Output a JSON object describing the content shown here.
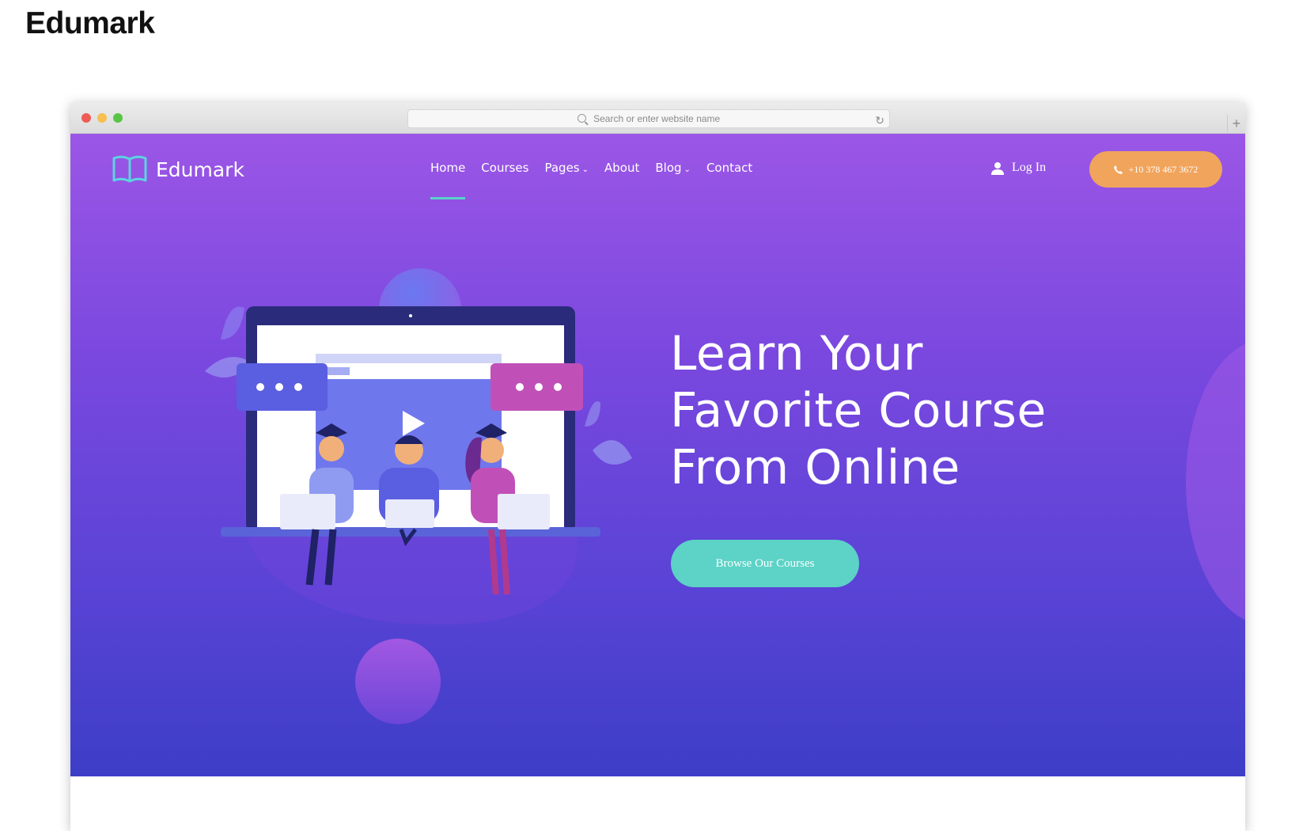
{
  "page": {
    "title": "Edumark"
  },
  "browser": {
    "address_placeholder": "Search or enter website name",
    "newtab_label": "+"
  },
  "site": {
    "logo_text": "Edumark",
    "nav": [
      {
        "label": "Home",
        "active": true,
        "dropdown": false
      },
      {
        "label": "Courses",
        "active": false,
        "dropdown": false
      },
      {
        "label": "Pages",
        "active": false,
        "dropdown": true
      },
      {
        "label": "About",
        "active": false,
        "dropdown": false
      },
      {
        "label": "Blog",
        "active": false,
        "dropdown": true
      },
      {
        "label": "Contact",
        "active": false,
        "dropdown": false
      }
    ],
    "login_label": "Log In",
    "phone": "+10 378 467 3672"
  },
  "hero": {
    "heading_lines": [
      "Learn Your",
      "Favorite Course",
      "From Online"
    ],
    "cta_label": "Browse Our Courses"
  },
  "colors": {
    "hero_top": "#9b56e6",
    "hero_bottom": "#3d3ec7",
    "accent_teal": "#5cd3c6",
    "accent_orange": "#f0a45c"
  }
}
